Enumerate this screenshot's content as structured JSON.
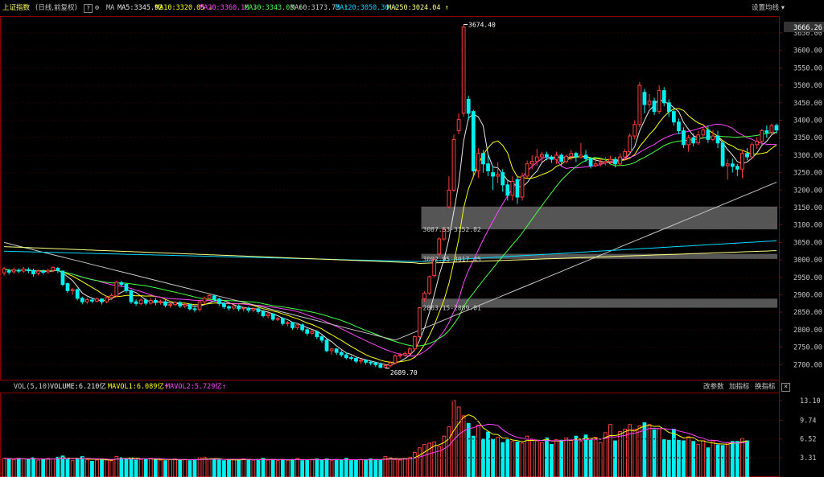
{
  "header": {
    "symbol": "上证指数",
    "period": "(日线,前复权)",
    "ma_label": "MA",
    "settings": "设置均线",
    "indicators": [
      {
        "label": "MA5:3345.92",
        "arrow": "",
        "color": "#e8e8e8"
      },
      {
        "label": "MA10:3320.05",
        "arrow": "↓",
        "color": "#ffff00"
      },
      {
        "label": "MA20:3360.16",
        "arrow": "↓",
        "color": "#ff44ff"
      },
      {
        "label": "MA30:3343.03",
        "arrow": "↑",
        "color": "#44ff44"
      },
      {
        "label": "MA60:3173.73",
        "arrow": "↑",
        "color": "#c8c8c8"
      },
      {
        "label": "MA120:3050.36",
        "arrow": "↑",
        "color": "#00d8ff"
      },
      {
        "label": "MA250:3024.04",
        "arrow": "↑",
        "color": "#ffff80"
      }
    ]
  },
  "volume_header": {
    "vol_label": "VOL(5,10)",
    "volume": "VOLUME:6.210亿",
    "mavol1": "MAVOL1:6.089亿",
    "mavol2": "MAVOL2:5.729亿",
    "buttons": [
      "改参数",
      "加指标",
      "换指标"
    ],
    "close": "×"
  },
  "chart_data": [
    {
      "type": "candlestick",
      "price_axis": {
        "min": 2680,
        "max": 3680,
        "ticks": [
          2700,
          2750,
          2800,
          2850,
          2900,
          2950,
          3000,
          3050,
          3100,
          3150,
          3200,
          3250,
          3300,
          3350,
          3400,
          3450,
          3500,
          3550,
          3600,
          3650
        ],
        "top_label": "3666.26"
      },
      "annotations": [
        {
          "text": "3674.40",
          "price": 3674.4,
          "index": 94
        },
        {
          "text": "2689.70",
          "price": 2689.7,
          "index": 78
        },
        {
          "text": "3087.53-3152.82",
          "price": 3087.53
        },
        {
          "text": "3002.95-3017.45",
          "price": 3002.95
        },
        {
          "text": "2863.15-2889.01",
          "price": 2863.15
        }
      ],
      "gaps": [
        [
          3087.53,
          3152.82
        ],
        [
          3002.95,
          3017.45
        ],
        [
          2863.15,
          2889.01
        ]
      ],
      "candles": [
        [
          2963,
          2975,
          2980,
          2955
        ],
        [
          2968,
          2965,
          2975,
          2958
        ],
        [
          2966,
          2972,
          2978,
          2960
        ],
        [
          2970,
          2968,
          2976,
          2962
        ],
        [
          2968,
          2974,
          2980,
          2963
        ],
        [
          2972,
          2969,
          2978,
          2962
        ],
        [
          2970,
          2960,
          2975,
          2952
        ],
        [
          2962,
          2968,
          2972,
          2955
        ],
        [
          2967,
          2965,
          2973,
          2958
        ],
        [
          2966,
          2970,
          2975,
          2960
        ],
        [
          2970,
          2978,
          2982,
          2965
        ],
        [
          2976,
          2970,
          2980,
          2962
        ],
        [
          2968,
          2930,
          2970,
          2925
        ],
        [
          2932,
          2912,
          2936,
          2905
        ],
        [
          2912,
          2915,
          2920,
          2900
        ],
        [
          2915,
          2890,
          2918,
          2884
        ],
        [
          2890,
          2880,
          2895,
          2873
        ],
        [
          2880,
          2886,
          2892,
          2874
        ],
        [
          2885,
          2882,
          2890,
          2876
        ],
        [
          2882,
          2888,
          2893,
          2878
        ],
        [
          2888,
          2880,
          2890,
          2872
        ],
        [
          2880,
          2892,
          2898,
          2876
        ],
        [
          2892,
          2898,
          2905,
          2885
        ],
        [
          2897,
          2936,
          2940,
          2893
        ],
        [
          2935,
          2930,
          2940,
          2922
        ],
        [
          2930,
          2912,
          2933,
          2905
        ],
        [
          2912,
          2880,
          2915,
          2874
        ],
        [
          2880,
          2875,
          2887,
          2868
        ],
        [
          2875,
          2885,
          2890,
          2870
        ],
        [
          2885,
          2876,
          2890,
          2870
        ],
        [
          2876,
          2884,
          2890,
          2872
        ],
        [
          2884,
          2878,
          2892,
          2870
        ],
        [
          2878,
          2880,
          2886,
          2872
        ],
        [
          2880,
          2870,
          2885,
          2864
        ],
        [
          2870,
          2872,
          2878,
          2863
        ],
        [
          2872,
          2878,
          2882,
          2867
        ],
        [
          2878,
          2868,
          2882,
          2862
        ],
        [
          2868,
          2872,
          2876,
          2862
        ],
        [
          2872,
          2860,
          2875,
          2855
        ],
        [
          2860,
          2858,
          2866,
          2850
        ],
        [
          2858,
          2880,
          2884,
          2852
        ],
        [
          2880,
          2890,
          2895,
          2873
        ],
        [
          2890,
          2898,
          2903,
          2885
        ],
        [
          2897,
          2888,
          2900,
          2880
        ],
        [
          2888,
          2875,
          2892,
          2868
        ],
        [
          2875,
          2866,
          2880,
          2860
        ],
        [
          2866,
          2862,
          2870,
          2855
        ],
        [
          2862,
          2868,
          2872,
          2857
        ],
        [
          2868,
          2860,
          2872,
          2853
        ],
        [
          2860,
          2862,
          2866,
          2852
        ],
        [
          2862,
          2856,
          2866,
          2849
        ],
        [
          2856,
          2860,
          2864,
          2850
        ],
        [
          2860,
          2852,
          2864,
          2846
        ],
        [
          2852,
          2840,
          2856,
          2835
        ],
        [
          2840,
          2845,
          2850,
          2833
        ],
        [
          2845,
          2830,
          2848,
          2825
        ],
        [
          2830,
          2832,
          2836,
          2824
        ],
        [
          2832,
          2818,
          2836,
          2812
        ],
        [
          2818,
          2820,
          2825,
          2810
        ],
        [
          2820,
          2806,
          2823,
          2800
        ],
        [
          2806,
          2814,
          2818,
          2800
        ],
        [
          2814,
          2800,
          2818,
          2794
        ],
        [
          2800,
          2790,
          2804,
          2783
        ],
        [
          2790,
          2795,
          2800,
          2785
        ],
        [
          2795,
          2780,
          2798,
          2773
        ],
        [
          2780,
          2770,
          2785,
          2762
        ],
        [
          2770,
          2740,
          2773,
          2735
        ],
        [
          2740,
          2745,
          2748,
          2728
        ],
        [
          2745,
          2735,
          2748,
          2728
        ],
        [
          2735,
          2728,
          2742,
          2722
        ],
        [
          2728,
          2720,
          2735,
          2715
        ],
        [
          2720,
          2718,
          2726,
          2712
        ],
        [
          2718,
          2710,
          2722,
          2704
        ],
        [
          2710,
          2713,
          2716,
          2702
        ],
        [
          2713,
          2707,
          2716,
          2700
        ],
        [
          2707,
          2705,
          2711,
          2698
        ],
        [
          2705,
          2700,
          2708,
          2693
        ],
        [
          2700,
          2692,
          2706,
          2690
        ],
        [
          2692,
          2697,
          2700,
          2690
        ],
        [
          2697,
          2705,
          2710,
          2692
        ],
        [
          2705,
          2725,
          2730,
          2700
        ],
        [
          2725,
          2728,
          2734,
          2718
        ],
        [
          2728,
          2732,
          2738,
          2722
        ],
        [
          2732,
          2745,
          2750,
          2728
        ],
        [
          2745,
          2780,
          2784,
          2740
        ],
        [
          2780,
          2863,
          2865,
          2775
        ],
        [
          2889,
          2905,
          2910,
          2880
        ],
        [
          2905,
          2952,
          2955,
          2900
        ],
        [
          2955,
          3002,
          3005,
          2950
        ],
        [
          3017,
          3060,
          3065,
          3010
        ],
        [
          3060,
          3087,
          3090,
          3055
        ],
        [
          3152,
          3200,
          3240,
          3148
        ],
        [
          3200,
          3345,
          3360,
          3195
        ],
        [
          3370,
          3402,
          3420,
          3360
        ],
        [
          3420,
          3667,
          3674,
          3410
        ],
        [
          3460,
          3420,
          3470,
          3400
        ],
        [
          3425,
          3255,
          3430,
          3240
        ],
        [
          3255,
          3305,
          3320,
          3235
        ],
        [
          3305,
          3275,
          3315,
          3250
        ],
        [
          3275,
          3255,
          3300,
          3240
        ],
        [
          3250,
          3240,
          3268,
          3200
        ],
        [
          3240,
          3245,
          3280,
          3220
        ],
        [
          3250,
          3215,
          3260,
          3195
        ],
        [
          3215,
          3185,
          3230,
          3170
        ],
        [
          3185,
          3225,
          3240,
          3170
        ],
        [
          3230,
          3180,
          3240,
          3160
        ],
        [
          3180,
          3240,
          3250,
          3170
        ],
        [
          3240,
          3275,
          3285,
          3235
        ],
        [
          3275,
          3282,
          3300,
          3260
        ],
        [
          3282,
          3295,
          3318,
          3270
        ],
        [
          3295,
          3302,
          3310,
          3280
        ],
        [
          3302,
          3295,
          3310,
          3285
        ],
        [
          3295,
          3288,
          3300,
          3278
        ],
        [
          3288,
          3300,
          3310,
          3275
        ],
        [
          3300,
          3282,
          3305,
          3270
        ],
        [
          3282,
          3296,
          3302,
          3276
        ],
        [
          3296,
          3305,
          3315,
          3285
        ],
        [
          3305,
          3295,
          3310,
          3280
        ],
        [
          3295,
          3300,
          3335,
          3290
        ],
        [
          3300,
          3290,
          3315,
          3280
        ],
        [
          3290,
          3270,
          3295,
          3262
        ],
        [
          3270,
          3275,
          3285,
          3265
        ],
        [
          3275,
          3278,
          3290,
          3268
        ],
        [
          3278,
          3282,
          3295,
          3270
        ],
        [
          3282,
          3288,
          3298,
          3275
        ],
        [
          3288,
          3275,
          3295,
          3265
        ],
        [
          3275,
          3295,
          3305,
          3270
        ],
        [
          3295,
          3310,
          3318,
          3285
        ],
        [
          3310,
          3355,
          3362,
          3300
        ],
        [
          3355,
          3388,
          3400,
          3345
        ],
        [
          3388,
          3500,
          3510,
          3380
        ],
        [
          3480,
          3445,
          3490,
          3420
        ],
        [
          3445,
          3455,
          3475,
          3435
        ],
        [
          3455,
          3425,
          3465,
          3415
        ],
        [
          3425,
          3485,
          3500,
          3418
        ],
        [
          3485,
          3450,
          3495,
          3440
        ],
        [
          3450,
          3425,
          3460,
          3410
        ],
        [
          3425,
          3395,
          3435,
          3385
        ],
        [
          3395,
          3370,
          3405,
          3360
        ],
        [
          3370,
          3330,
          3380,
          3320
        ],
        [
          3330,
          3350,
          3358,
          3310
        ],
        [
          3350,
          3335,
          3362,
          3325
        ],
        [
          3335,
          3358,
          3370,
          3330
        ],
        [
          3358,
          3372,
          3380,
          3350
        ],
        [
          3372,
          3345,
          3385,
          3335
        ],
        [
          3345,
          3355,
          3372,
          3340
        ],
        [
          3355,
          3335,
          3370,
          3320
        ],
        [
          3335,
          3270,
          3340,
          3265
        ],
        [
          3270,
          3275,
          3288,
          3230
        ],
        [
          3275,
          3268,
          3290,
          3250
        ],
        [
          3268,
          3260,
          3275,
          3240
        ],
        [
          3260,
          3305,
          3315,
          3235
        ],
        [
          3305,
          3295,
          3320,
          3285
        ],
        [
          3295,
          3330,
          3338,
          3288
        ],
        [
          3330,
          3340,
          3352,
          3318
        ],
        [
          3340,
          3370,
          3375,
          3330
        ],
        [
          3370,
          3365,
          3385,
          3350
        ],
        [
          3365,
          3385,
          3390,
          3358
        ],
        [
          3385,
          3372,
          3390,
          3362
        ]
      ]
    },
    {
      "type": "bar",
      "name": "VOL(5,10)",
      "axis": {
        "min": 0,
        "max": 13.1,
        "ticks": [
          "3.31",
          "6.52",
          "9.74",
          "13.10"
        ]
      },
      "values": [
        3.2,
        3.1,
        3.0,
        3.2,
        3.1,
        3.0,
        3.3,
        2.9,
        3.0,
        3.2,
        3.1,
        3.4,
        3.6,
        3.0,
        2.8,
        3.2,
        3.5,
        3.0,
        2.7,
        2.9,
        3.1,
        3.0,
        2.8,
        3.5,
        3.3,
        3.2,
        3.3,
        2.9,
        3.0,
        3.1,
        3.2,
        3.0,
        2.9,
        2.8,
        3.0,
        3.1,
        2.9,
        3.0,
        2.8,
        3.0,
        3.3,
        3.4,
        3.1,
        3.0,
        2.9,
        2.8,
        3.0,
        3.0,
        2.9,
        3.1,
        3.0,
        2.9,
        3.0,
        3.2,
        2.9,
        3.0,
        2.8,
        3.0,
        2.9,
        3.0,
        3.2,
        2.8,
        2.9,
        3.0,
        3.1,
        2.9,
        3.1,
        2.8,
        3.0,
        2.9,
        3.2,
        2.8,
        2.9,
        3.0,
        2.9,
        3.1,
        3.0,
        2.9,
        3.5,
        3.3,
        3.0,
        2.9,
        3.1,
        3.4,
        4.2,
        5.0,
        5.6,
        5.8,
        6.0,
        5.2,
        7.0,
        8.6,
        13.1,
        12.0,
        10.5,
        9.2,
        7.0,
        8.9,
        6.5,
        7.7,
        6.5,
        6.8,
        5.9,
        6.4,
        6.1,
        6.0,
        5.8,
        7.0,
        6.5,
        6.2,
        5.9,
        6.7,
        5.6,
        6.4,
        6.3,
        6.7,
        6.3,
        7.0,
        6.1,
        7.2,
        6.3,
        6.8,
        5.9,
        7.6,
        9.0,
        6.2,
        7.8,
        8.2,
        9.0,
        8.2,
        8.8,
        9.3,
        9.0,
        8.1,
        8.3,
        6.4,
        6.3,
        8.2,
        6.3,
        6.2,
        6.9,
        6.1,
        5.6,
        6.2,
        5.0,
        6.2,
        5.5,
        5.4,
        5.9,
        6.1,
        6.1,
        6.6,
        6.2
      ],
      "ma": [
        {
          "name": "MAVOL1",
          "color": "#ffff00"
        },
        {
          "name": "MAVOL2",
          "color": "#ff44ff"
        }
      ]
    }
  ],
  "colors": {
    "up": "#ff3c3c",
    "down": "#00f0f0",
    "grid": "#2a0000",
    "axis": "#8a0000",
    "gap": "#c8c8c8",
    "text": "#c8c8c8"
  }
}
